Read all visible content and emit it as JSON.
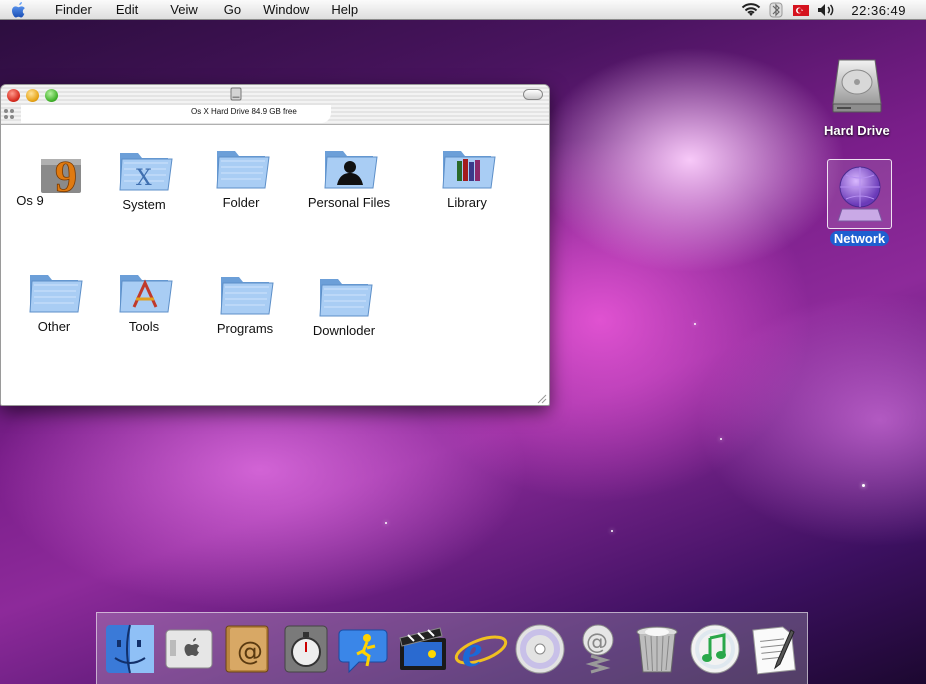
{
  "menubar": {
    "items": [
      "Finder",
      "Edit",
      "Veiw",
      "Go",
      "Window",
      "Help"
    ],
    "clock": "22:36:49",
    "status_icons": [
      "wifi-icon",
      "bluetooth-icon",
      "flag-icon",
      "volume-icon"
    ]
  },
  "finder_window": {
    "status_text": "Os X Hard Drive 84.9 GB free",
    "items": [
      "Os 9",
      "System",
      "Folder",
      "Personal Files",
      "Library",
      "Other",
      "Tools",
      "Programs",
      "Downloder"
    ]
  },
  "desktop": {
    "icons": [
      "Hard Drive",
      "Network"
    ]
  },
  "dock": {
    "items": [
      "finder-icon",
      "system-preferences-icon",
      "address-book-icon",
      "stopwatch-icon",
      "aim-icon",
      "imovie-icon",
      "internet-explorer-icon",
      "dvd-player-icon",
      "mail-icon",
      "trash-icon",
      "itunes-icon",
      "textedit-icon"
    ]
  },
  "colors": {
    "selection": "#1f5fd0",
    "folder_blue": "#7fb0e8"
  }
}
